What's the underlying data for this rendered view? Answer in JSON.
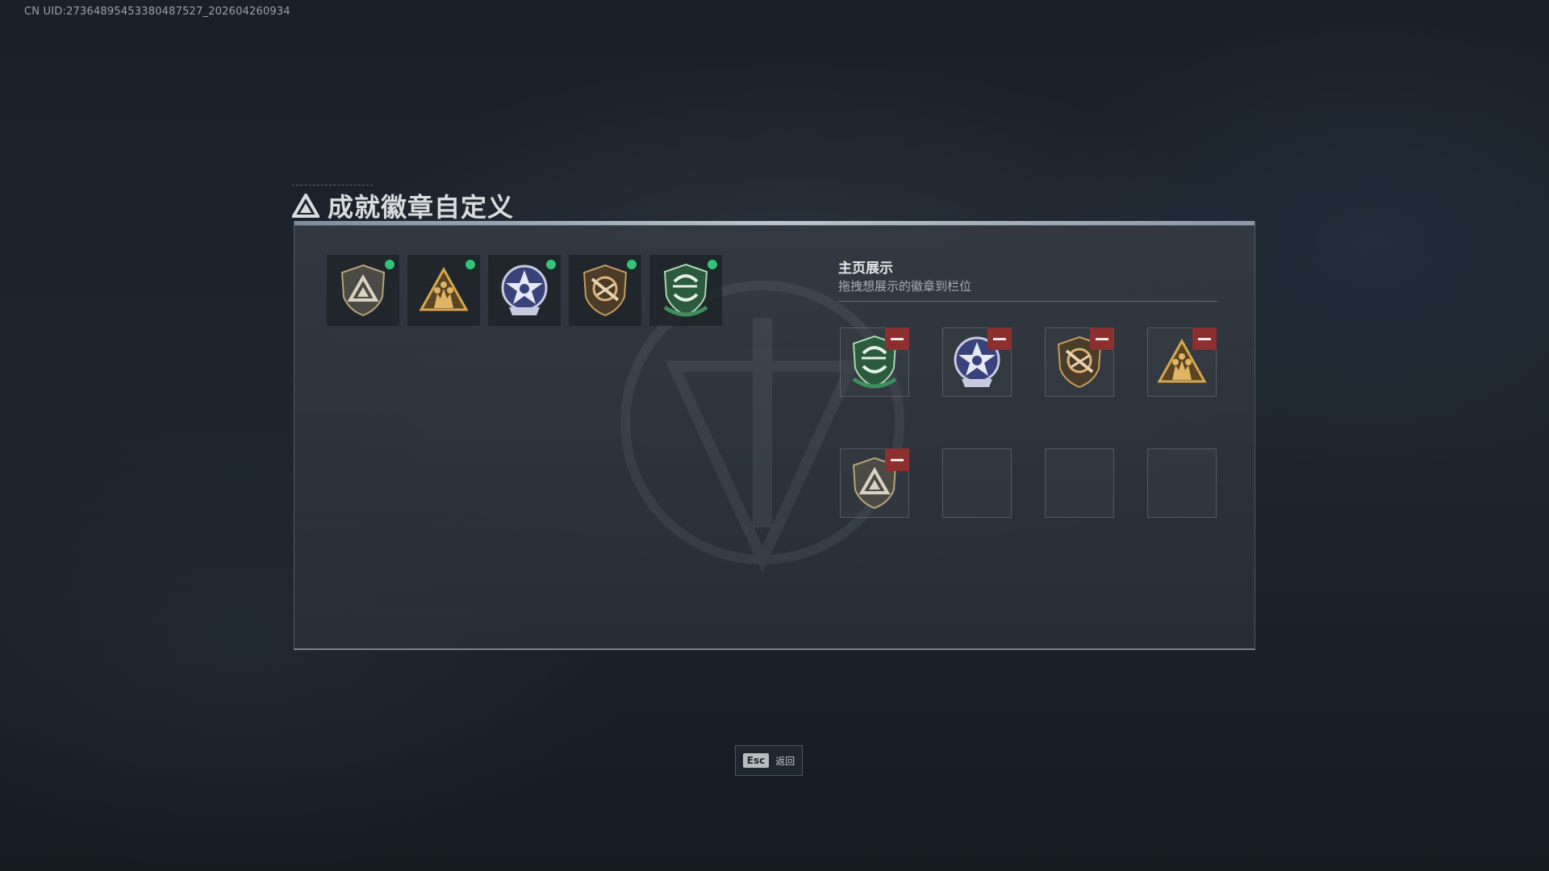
{
  "uid_text": "CN UID:273648954533804875​27_202604260934",
  "title": "成就徽章自定义",
  "inventory": {
    "badges": [
      {
        "icon": "shield-triangle-badge-icon",
        "owned": true
      },
      {
        "icon": "gold-triangle-soldiers-badge-icon",
        "owned": true
      },
      {
        "icon": "blue-star-badge-icon",
        "owned": true
      },
      {
        "icon": "rifle-shield-badge-icon",
        "owned": true
      },
      {
        "icon": "green-arrows-shield-badge-icon",
        "owned": true
      }
    ],
    "status_color": "#34c27a"
  },
  "showcase": {
    "title": "主页展示",
    "subtitle": "拖拽想展示的徽章到栏位",
    "slots": [
      {
        "badge": "green-arrows-shield-badge-icon",
        "removable": true
      },
      {
        "badge": "blue-star-badge-icon",
        "removable": true
      },
      {
        "badge": "rifle-shield-badge-icon",
        "removable": true
      },
      {
        "badge": "gold-triangle-soldiers-badge-icon",
        "removable": true
      },
      {
        "badge": "shield-triangle-badge-icon",
        "removable": true
      },
      {
        "badge": null,
        "removable": false
      },
      {
        "badge": null,
        "removable": false
      },
      {
        "badge": null,
        "removable": false
      }
    ],
    "remove_color": "#8e2f2f"
  },
  "footer": {
    "key_label": "Esc",
    "action_label": "返回"
  }
}
